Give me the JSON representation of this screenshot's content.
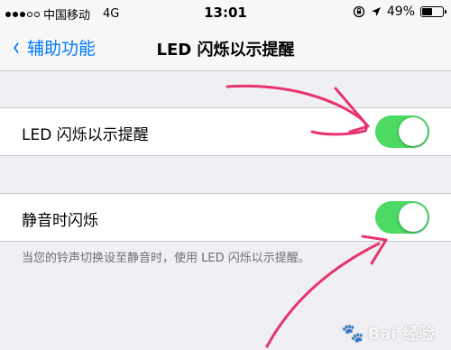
{
  "status_bar": {
    "carrier": "中国移动",
    "network": "4G",
    "time": "13:01",
    "battery_percent": "49%",
    "battery_level": 0.49,
    "signal_bars": 3,
    "signal_total": 5
  },
  "nav": {
    "back_label": "辅助功能",
    "title": "LED 闪烁以示提醒"
  },
  "settings": {
    "led_flash": {
      "label": "LED 闪烁以示提醒",
      "enabled": true
    },
    "flash_on_silent": {
      "label": "静音时闪烁",
      "enabled": true
    },
    "footer": "当您的铃声切换设至静音时，使用 LED 闪烁以示提醒。"
  },
  "watermark": {
    "text": "Bai 经验"
  },
  "colors": {
    "accent": "#007aff",
    "toggle_on": "#4cd964",
    "annotation": "#e8336d"
  }
}
